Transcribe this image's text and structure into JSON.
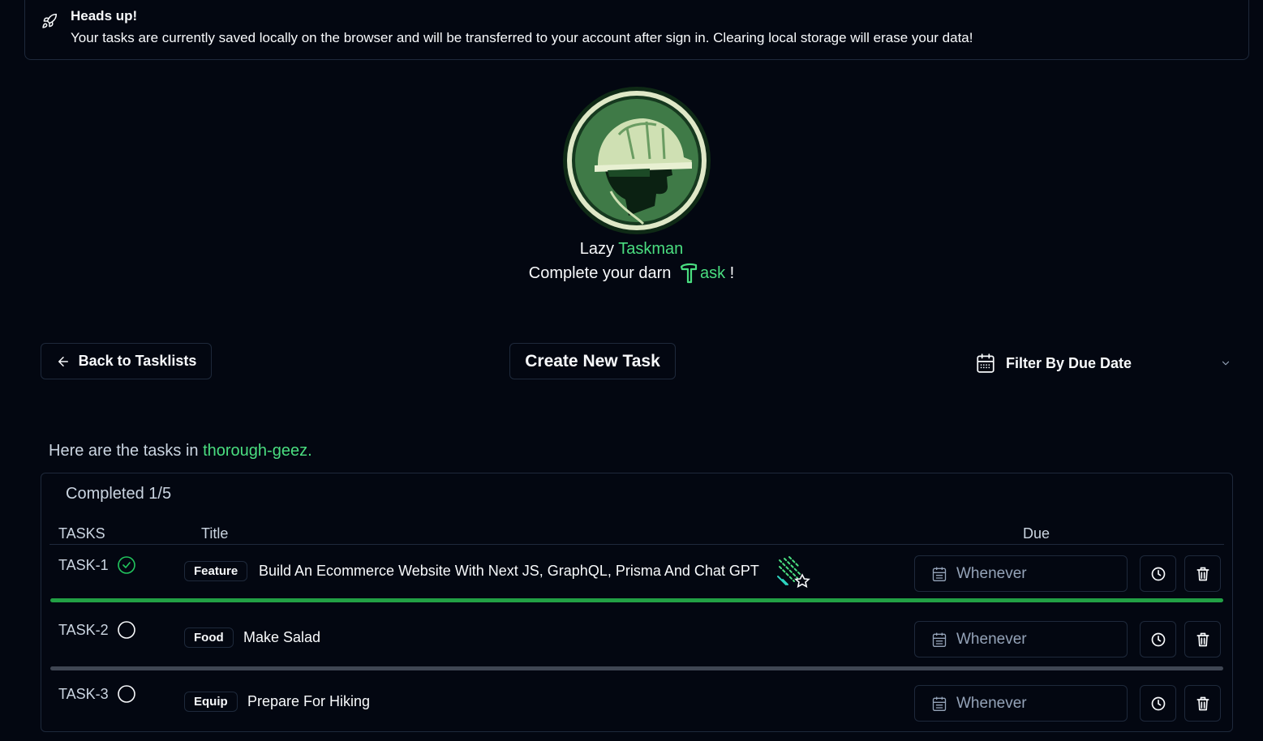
{
  "alert": {
    "title": "Heads up!",
    "body": "Your tasks are currently saved locally on the browser and will be transferred to your account after sign in. Clearing local storage will erase your data!",
    "icon": "rocket-icon"
  },
  "brand": {
    "word1": "Lazy",
    "word2": "Taskman",
    "tagline_start": "Complete your darn",
    "tagline_accent": "ask",
    "tagline_end": "!"
  },
  "toolbar": {
    "back_label": "Back to Tasklists",
    "create_label": "Create New Task",
    "filter_label": "Filter By Due Date"
  },
  "intro": {
    "prefix": "Here are the tasks in",
    "list_name": "thorough-geez",
    "suffix": "."
  },
  "table": {
    "completed": "Completed 1/5",
    "headers": {
      "tasks": "TASKS",
      "title": "Title",
      "due": "Due"
    },
    "rows": [
      {
        "id": "TASK-1",
        "done": true,
        "badge": "Feature",
        "title": "Build An Ecommerce Website With Next JS, GraphQL, Prisma And Chat GPT",
        "due": "Whenever",
        "progress": 1.0
      },
      {
        "id": "TASK-2",
        "done": false,
        "badge": "Food",
        "title": "Make Salad",
        "due": "Whenever",
        "progress": 0.0
      },
      {
        "id": "TASK-3",
        "done": false,
        "badge": "Equip",
        "title": "Prepare For Hiking",
        "due": "Whenever",
        "progress": 0.0
      }
    ]
  },
  "colors": {
    "background": "#030711",
    "accent": "#4ade80",
    "progress_done": "#22a045",
    "progress_empty": "#3f4653",
    "border": "#1e293b"
  }
}
